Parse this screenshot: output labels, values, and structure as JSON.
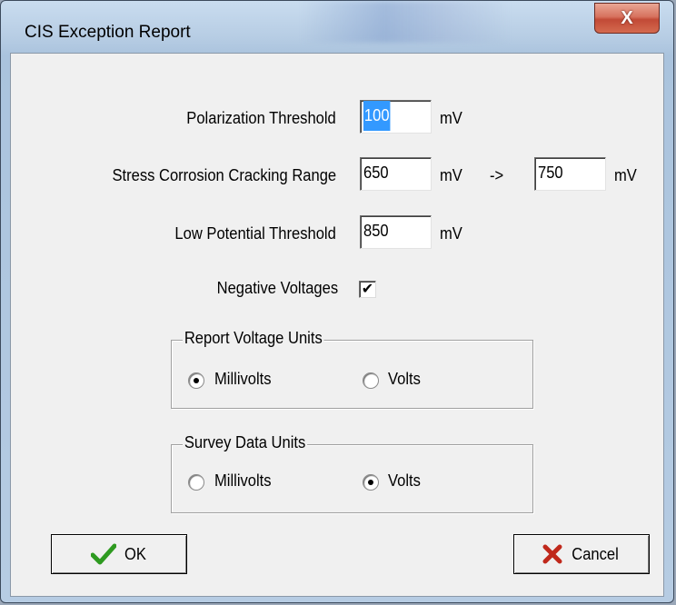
{
  "window": {
    "title": "CIS Exception Report",
    "close_label": "X"
  },
  "form": {
    "polarization": {
      "label": "Polarization Threshold",
      "value": "100",
      "unit": "mV"
    },
    "scc": {
      "label": "Stress Corrosion Cracking Range",
      "from_value": "650",
      "from_unit": "mV",
      "arrow": "->",
      "to_value": "750",
      "to_unit": "mV"
    },
    "low_potential": {
      "label": "Low Potential Threshold",
      "value": "850",
      "unit": "mV"
    },
    "negative_voltages": {
      "label": "Negative Voltages",
      "checked": true,
      "mark": "✔"
    }
  },
  "report_units": {
    "title": "Report Voltage Units",
    "options": [
      {
        "label": "Millivolts",
        "selected": true
      },
      {
        "label": "Volts",
        "selected": false
      }
    ]
  },
  "survey_units": {
    "title": "Survey Data Units",
    "options": [
      {
        "label": "Millivolts",
        "selected": false
      },
      {
        "label": "Volts",
        "selected": true
      }
    ]
  },
  "buttons": {
    "ok": {
      "label": "OK",
      "icon": "check-icon",
      "icon_color": "#2e9a20"
    },
    "cancel": {
      "label": "Cancel",
      "icon": "x-icon",
      "icon_color": "#c0281b"
    }
  }
}
